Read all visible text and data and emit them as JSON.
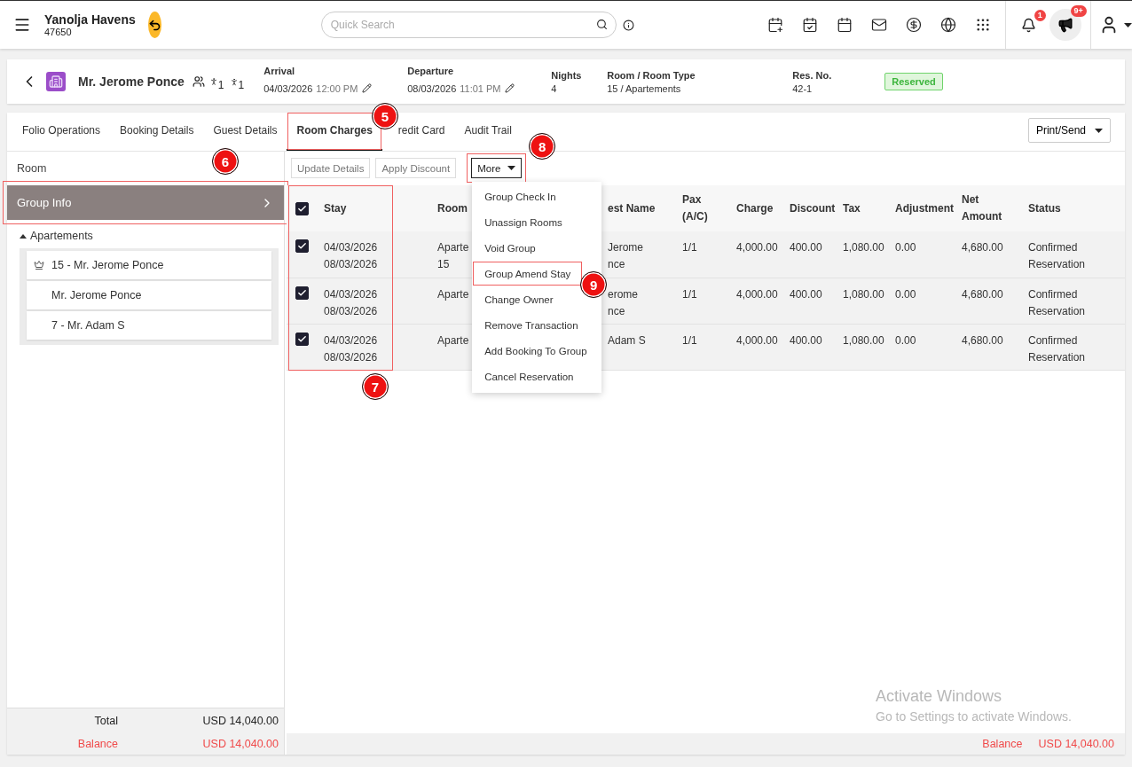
{
  "topbar": {
    "hotel_name": "Yanolja Havens",
    "hotel_id": "47650",
    "search": {
      "placeholder": "Quick Search"
    },
    "notifications": {
      "count": "1"
    },
    "announcements": {
      "count": "9+"
    }
  },
  "reservation": {
    "guest_name": "Mr. Jerome Ponce",
    "adults": "1",
    "children": "1",
    "fields": [
      {
        "label": "Arrival",
        "value": "04/03/2026",
        "time": "12:00 PM",
        "editable": true
      },
      {
        "label": "Departure",
        "value": "08/03/2026",
        "time": "11:01 PM",
        "editable": true
      },
      {
        "label": "Nights",
        "value": "4",
        "editable": false
      },
      {
        "label": "Room / Room Type",
        "value": "15 / Apartements",
        "editable": false
      },
      {
        "label": "Res. No.",
        "value": "42-1",
        "editable": false
      }
    ],
    "status": "Reserved"
  },
  "tabs": [
    {
      "label": "Folio Operations",
      "selected": false
    },
    {
      "label": "Booking Details",
      "selected": false
    },
    {
      "label": "Guest Details",
      "selected": false
    },
    {
      "label": "Room Charges",
      "selected": true,
      "callout": "5"
    },
    {
      "label": "redit Card",
      "selected": false
    },
    {
      "label": "Audit Trail",
      "selected": false
    }
  ],
  "print_send": "Print/Send",
  "sidebar": {
    "title": "Room",
    "group_info": {
      "label": "Group Info",
      "callout": "6"
    },
    "room_type": {
      "label": "Apartements",
      "expanded": true
    },
    "rooms": [
      {
        "label": "15 - Mr. Jerome Ponce",
        "owner": true
      },
      {
        "label": "Mr. Jerome Ponce",
        "owner": false
      },
      {
        "label": "7 - Mr. Adam S",
        "owner": false
      }
    ],
    "total": {
      "label": "Total",
      "value": "USD 14,040.00"
    },
    "balance": {
      "label": "Balance",
      "value": "USD 14,040.00"
    }
  },
  "toolbar": {
    "buttons": [
      {
        "label": "Update Details"
      },
      {
        "label": "Apply Discount"
      }
    ],
    "more": {
      "label": "More",
      "expanded": true,
      "callout": "8"
    },
    "menu": [
      {
        "label": "Group Check In"
      },
      {
        "label": "Unassign Rooms"
      },
      {
        "label": "Void Group"
      },
      {
        "label": "Group Amend Stay",
        "callout": "9"
      },
      {
        "label": "Change Owner"
      },
      {
        "label": "Remove Transaction"
      },
      {
        "label": "Add Booking To Group"
      },
      {
        "label": "Cancel Reservation"
      }
    ]
  },
  "table": {
    "all_checked": true,
    "stay_callout": "7",
    "columns": [
      "Stay",
      "Room",
      "est Name",
      "Pax (A/C)",
      "Charge",
      "Discount",
      "Tax",
      "Adjustment",
      "Net Amount",
      "Status"
    ],
    "rows": [
      {
        "checked": true,
        "stay": [
          "04/03/2026",
          "08/03/2026"
        ],
        "room": [
          "Aparte",
          "15"
        ],
        "guest": [
          "Jerome",
          "nce"
        ],
        "pax": "1/1",
        "charge": "4,000.00",
        "discount": "400.00",
        "tax": "1,080.00",
        "adjustment": "0.00",
        "net_amount": "4,680.00",
        "status": "Confirmed Reservation"
      },
      {
        "checked": true,
        "stay": [
          "04/03/2026",
          "08/03/2026"
        ],
        "room": [
          "Aparte"
        ],
        "guest": [
          "erome",
          "nce"
        ],
        "pax": "1/1",
        "charge": "4,000.00",
        "discount": "400.00",
        "tax": "1,080.00",
        "adjustment": "0.00",
        "net_amount": "4,680.00",
        "status": "Confirmed Reservation"
      },
      {
        "checked": true,
        "stay": [
          "04/03/2026",
          "08/03/2026"
        ],
        "room": [
          "Aparte"
        ],
        "guest": [
          "Adam S"
        ],
        "pax": "1/1",
        "charge": "4,000.00",
        "discount": "400.00",
        "tax": "1,080.00",
        "adjustment": "0.00",
        "net_amount": "4,680.00",
        "status": "Confirmed Reservation"
      }
    ]
  },
  "footer": {
    "balance_label": "Balance",
    "balance_value": "USD 14,040.00"
  },
  "os_notice": {
    "title": "Activate Windows",
    "text": "Go to Settings to activate Windows."
  }
}
